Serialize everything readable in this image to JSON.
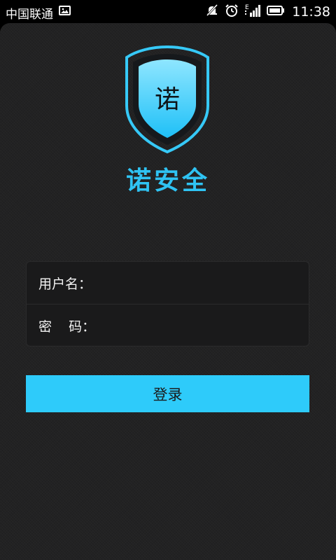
{
  "status_bar": {
    "carrier": "中国联通",
    "time": "11:38",
    "network_type": "E",
    "icons": [
      "gallery-icon",
      "mute-icon",
      "alarm-icon",
      "signal-icon",
      "battery-icon"
    ]
  },
  "app": {
    "logo_char": "诺",
    "title": "诺安全"
  },
  "form": {
    "username_label": "用户名：",
    "username_value": "",
    "password_label": "密    码：",
    "password_value": ""
  },
  "login_button": {
    "label": "登录"
  },
  "colors": {
    "accent": "#2ecbfa",
    "title": "#2fc3f3",
    "background": "#222223"
  }
}
